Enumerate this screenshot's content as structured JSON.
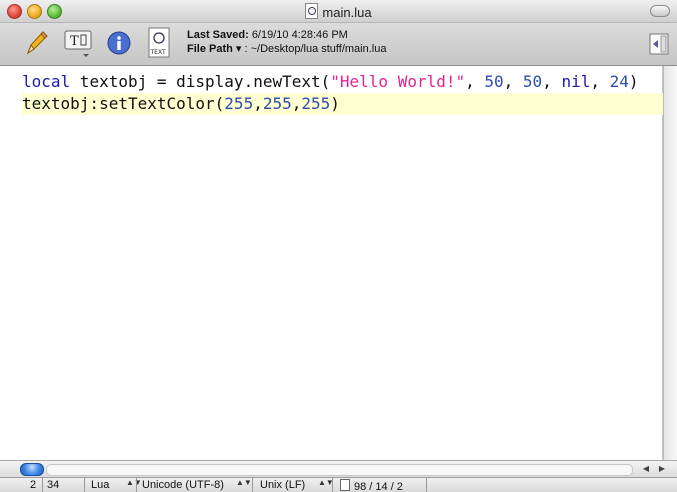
{
  "window": {
    "title": "main.lua"
  },
  "toolbar": {
    "last_saved_label": "Last Saved:",
    "last_saved_value": "6/19/10 4:28:46 PM",
    "file_path_label": "File Path",
    "file_path_sep": ":",
    "file_path_value": "~/Desktop/lua stuff/main.lua",
    "textfile_caption": "TEXT"
  },
  "editor": {
    "lines": [
      [
        {
          "t": "local",
          "c": "kw"
        },
        {
          "t": " textobj = display.newText(",
          "c": ""
        },
        {
          "t": "\"Hello World!\"",
          "c": "str"
        },
        {
          "t": ", ",
          "c": ""
        },
        {
          "t": "50",
          "c": "num"
        },
        {
          "t": ", ",
          "c": ""
        },
        {
          "t": "50",
          "c": "num"
        },
        {
          "t": ", ",
          "c": ""
        },
        {
          "t": "nil",
          "c": "kw"
        },
        {
          "t": ", ",
          "c": ""
        },
        {
          "t": "24",
          "c": "num"
        },
        {
          "t": ")",
          "c": ""
        }
      ],
      [
        {
          "t": "textobj:setTextColor(",
          "c": ""
        },
        {
          "t": "255",
          "c": "num"
        },
        {
          "t": ",",
          "c": ""
        },
        {
          "t": "255",
          "c": "num"
        },
        {
          "t": ",",
          "c": ""
        },
        {
          "t": "255",
          "c": "num"
        },
        {
          "t": ")",
          "c": ""
        }
      ]
    ]
  },
  "status": {
    "line": "2",
    "column": "34",
    "syntax": "Lua",
    "encoding": "Unicode (UTF-8)",
    "line_endings": "Unix (LF)",
    "counts": "98 / 14 / 2"
  }
}
